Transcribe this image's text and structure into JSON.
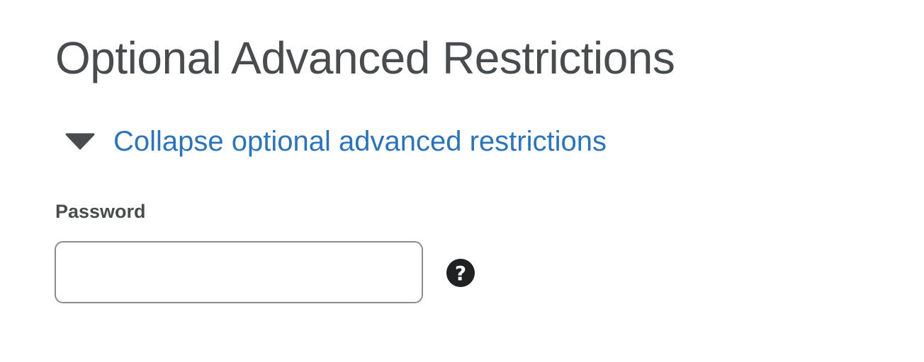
{
  "section": {
    "title": "Optional Advanced Restrictions"
  },
  "toggle": {
    "label": "Collapse optional advanced restrictions",
    "icon": "caret-down-icon"
  },
  "password": {
    "label": "Password",
    "value": "",
    "help_icon": "question-circle-icon",
    "help_glyph": "?"
  },
  "colors": {
    "title": "#494c4e",
    "link": "#2d73b8",
    "input_border": "#8a8d8f",
    "help_icon_bg": "#202122"
  }
}
